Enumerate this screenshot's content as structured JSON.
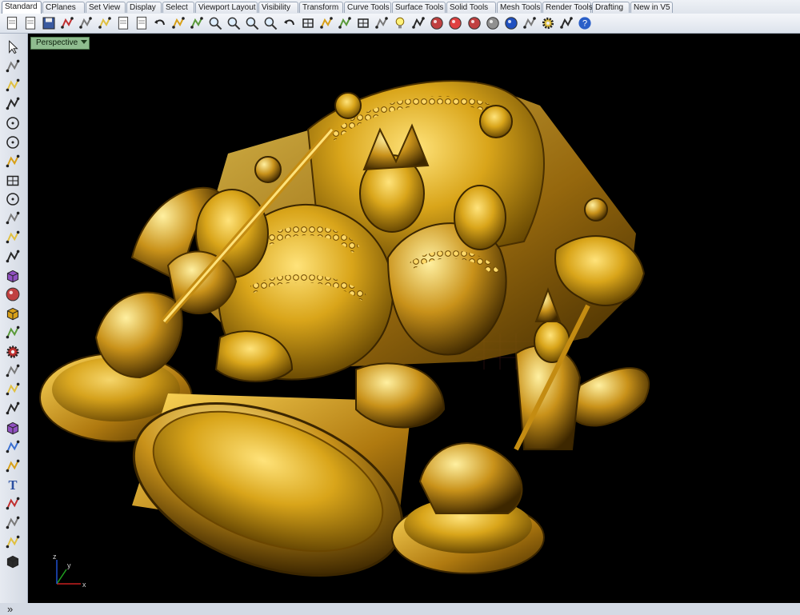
{
  "tabs": [
    "Standard",
    "CPlanes",
    "Set View",
    "Display",
    "Select",
    "Viewport Layout",
    "Visibility",
    "Transform",
    "Curve Tools",
    "Surface Tools",
    "Solid Tools",
    "Mesh Tools",
    "Render Tools",
    "Drafting",
    "New in V5"
  ],
  "active_tab": "Standard",
  "viewport": {
    "label": "Perspective"
  },
  "axis_labels": {
    "x": "x",
    "y": "y",
    "z": "z"
  },
  "more_tools": "»",
  "toolbar_icons": [
    "new-file-icon",
    "open-file-icon",
    "save-icon",
    "print-icon",
    "import-icon",
    "cut-icon",
    "copy-icon",
    "paste-icon",
    "undo-icon",
    "pan-hand-icon",
    "rotate-view-icon",
    "zoom-dynamic-icon",
    "zoom-window-icon",
    "zoom-extents-icon",
    "zoom-selected-icon",
    "undo-view-icon",
    "four-viewports-icon",
    "car-icon",
    "hide-icon",
    "grid-snap-icon",
    "points-icon",
    "light-bulb-icon",
    "layer-icon",
    "render-sphere-icon",
    "color-wheel-icon",
    "shaded-sphere-icon",
    "metal-sphere-icon",
    "globe-sphere-icon",
    "flashlight-icon",
    "gear-options-icon",
    "dimension-icon",
    "help-icon"
  ],
  "left_icons": [
    "select-arrow-icon",
    "point-icon",
    "polyline-icon",
    "curve-icon",
    "circle-icon",
    "ellipse-icon",
    "polygon-icon",
    "rectangle-icon",
    "arc-icon",
    "free-curve-icon",
    "fillet-icon",
    "surface-icon",
    "box-icon",
    "sphere-icon",
    "cylinder-icon",
    "plane-icon",
    "gear-icon",
    "boolean-icon",
    "align-icon",
    "dimension-tool-icon",
    "solid-icon",
    "sweep-icon",
    "offset-icon",
    "text-icon",
    "array-icon",
    "group-icon",
    "explode-icon",
    "block-icon"
  ],
  "colors": {
    "gold": "#d4a017",
    "viewport_bg": "#000000"
  }
}
